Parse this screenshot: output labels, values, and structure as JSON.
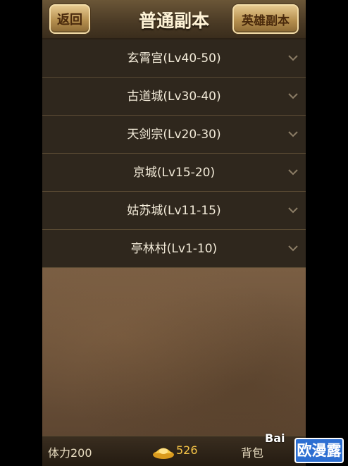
{
  "header": {
    "back_label": "返回",
    "title": "普通副本",
    "hero_label": "英雄副本"
  },
  "dungeons": [
    {
      "label": "玄霄宫(Lv40-50)"
    },
    {
      "label": "古道城(Lv30-40)"
    },
    {
      "label": "天剑宗(Lv20-30)"
    },
    {
      "label": "京城(Lv15-20)"
    },
    {
      "label": "姑苏城(Lv11-15)"
    },
    {
      "label": "亭林村(Lv1-10)"
    }
  ],
  "footer": {
    "stamina": "体力200",
    "gold": "526",
    "bag": "背包"
  },
  "watermark": {
    "baidu": "Bai",
    "badge": "欧漫露"
  },
  "colors": {
    "button_gold": "#c9a566",
    "gold_text": "#f5c447",
    "row_bg": "#2f271d"
  },
  "icons": [
    "chevron-down-icon",
    "gold-ingot-icon"
  ]
}
